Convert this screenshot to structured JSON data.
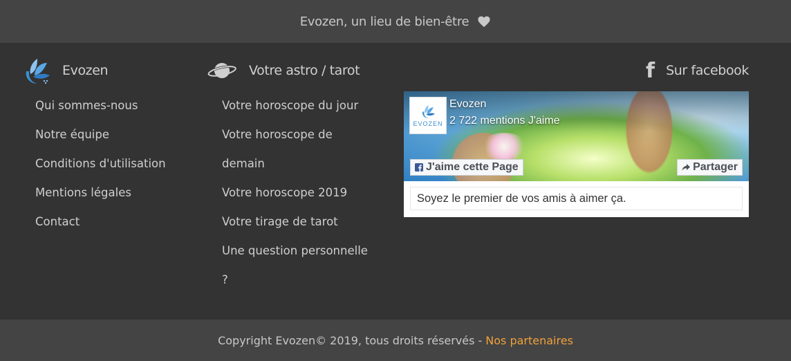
{
  "topbar": {
    "tagline": "Evozen, un lieu de bien-être",
    "icon": "heart-icon"
  },
  "columns": {
    "evozen": {
      "title": "Evozen",
      "icon": "evozen-lotus-logo-icon",
      "links": [
        "Qui sommes-nous",
        "Notre équipe",
        "Conditions d'utilisation",
        "Mentions légales",
        "Contact"
      ]
    },
    "astro": {
      "title": "Votre astro / tarot",
      "icon": "planet-icon",
      "links": [
        "Votre horoscope du jour",
        "Votre horoscope de demain",
        "Votre horoscope 2019",
        "Votre tirage de tarot",
        "Une question personnelle ?"
      ]
    },
    "facebook": {
      "title": "Sur facebook",
      "icon": "facebook-icon"
    }
  },
  "fb_widget": {
    "page_name": "Evozen",
    "logo_text": "EVOZEN",
    "likes_text": "2 722 mentions J'aime",
    "like_button": "J'aime cette Page",
    "share_button": "Partager",
    "friends_text": "Soyez le premier de vos amis à aimer ça."
  },
  "footer": {
    "copyright": "Copyright Evozen© 2019, tous droits réservés",
    "separator": "-",
    "partners_link": "Nos partenaires"
  },
  "colors": {
    "background": "#333333",
    "bars": "#444444",
    "accent": "#f0a23a",
    "logo_blue": "#3a8fd0"
  }
}
